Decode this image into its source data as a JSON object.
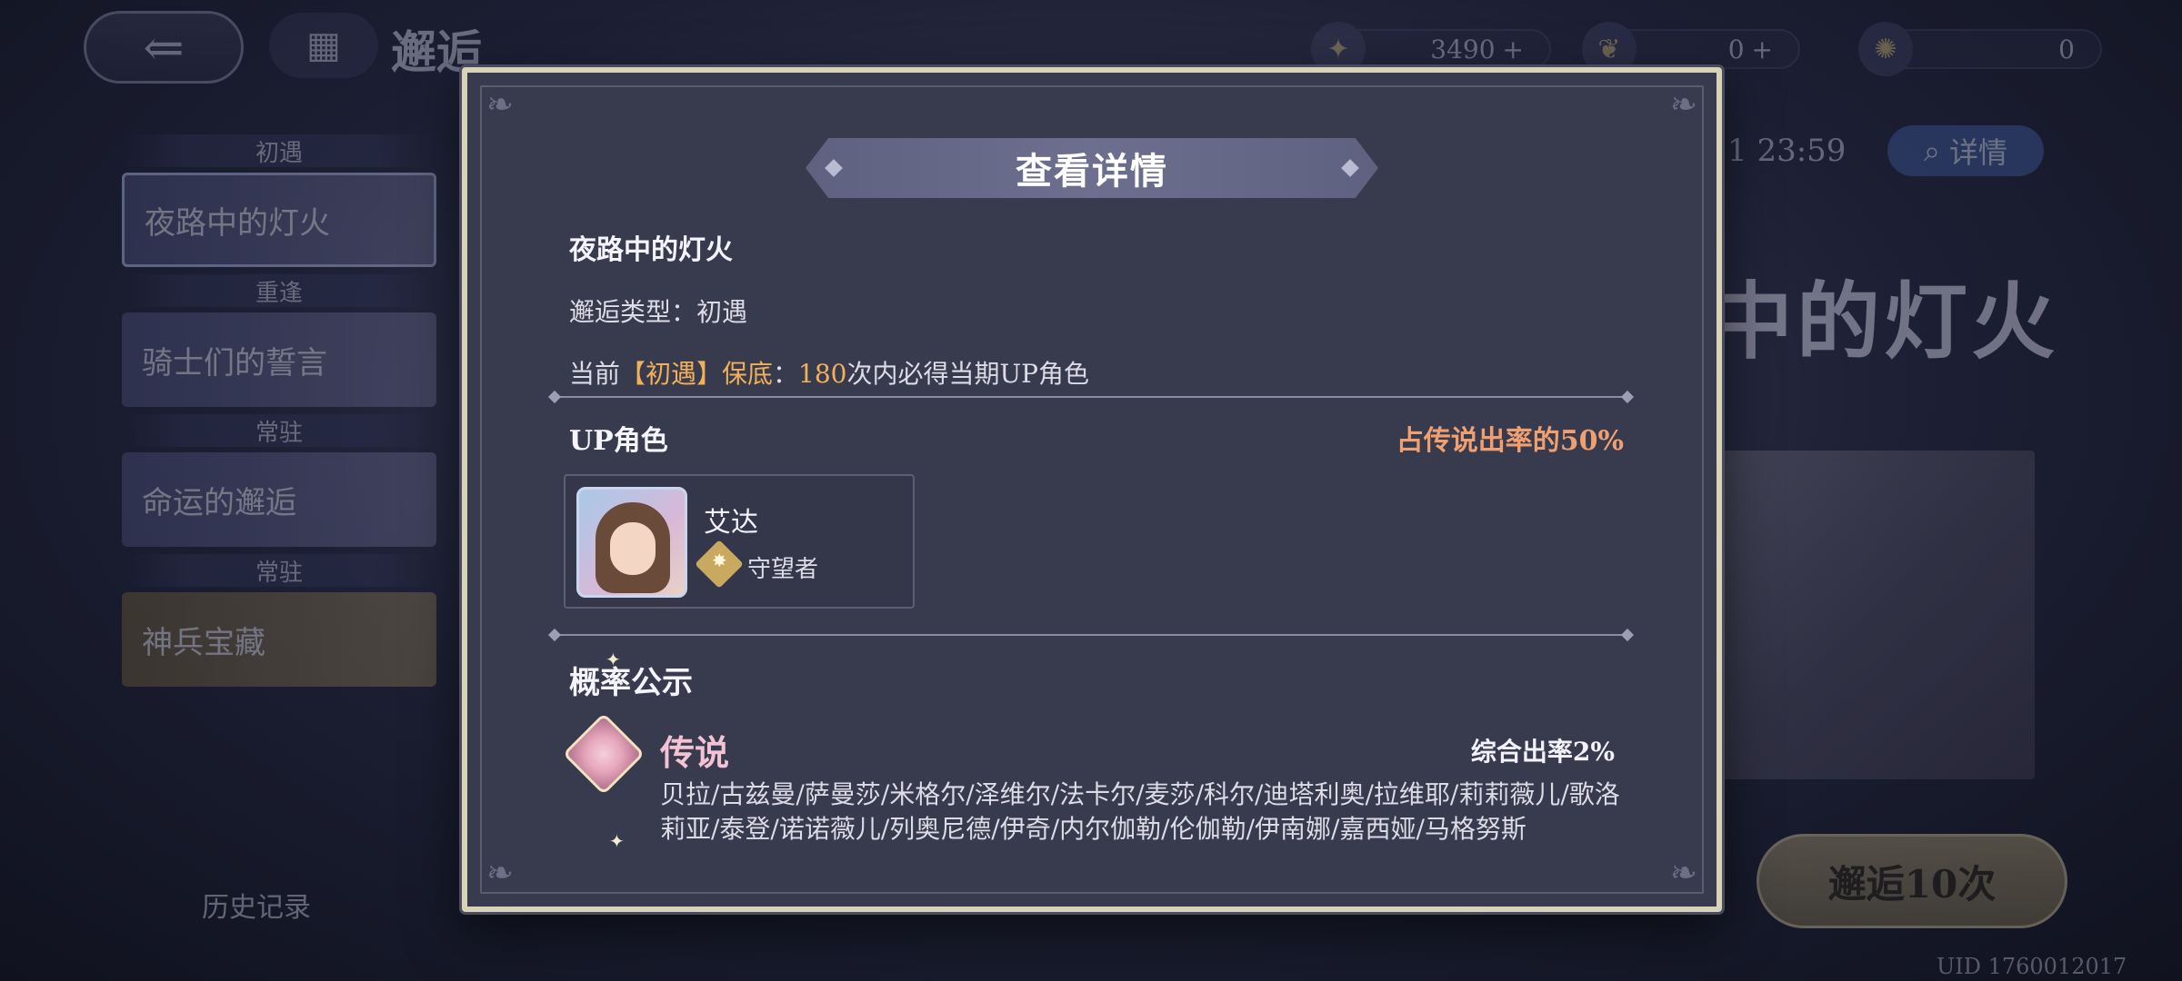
{
  "background": {
    "screen_title": "邂逅",
    "menu_icon": "grid-icon",
    "currencies": [
      {
        "icon": "crystal-icon",
        "value": "3490",
        "plus": "+"
      },
      {
        "icon": "feather-icon",
        "value": "0",
        "plus": "+"
      },
      {
        "icon": "flame-icon",
        "value": "0",
        "plus": ""
      }
    ],
    "side_list": [
      {
        "header": "初遇",
        "card": "夜路中的灯火",
        "active": true
      },
      {
        "header": "重逢",
        "card": "骑士们的誓言",
        "active": false
      },
      {
        "header": "常驻",
        "card": "命运的邂逅",
        "active": false
      },
      {
        "header": "常驻",
        "card": "神兵宝藏",
        "active": false
      }
    ],
    "history": "历史记录",
    "timer": "1   23:59",
    "details_button": "详情",
    "banner_title": "中的灯火",
    "pull_button": "邂逅10次",
    "pull_cost": "10",
    "uid": "UID 1760012017"
  },
  "modal": {
    "title": "查看详情",
    "banner_name": "夜路中的灯火",
    "type_label": "邂逅类型：",
    "type_value": "初遇",
    "pity_prefix": "当前",
    "pity_highlight": "【初遇】保底",
    "pity_colon": "：",
    "pity_count": "180",
    "pity_suffix": "次内必得当期UP角色",
    "up_label": "UP角色",
    "up_rate": "占传说出率的50%",
    "character": {
      "name": "艾达",
      "role_icon": "watcher-icon",
      "role": "守望者"
    },
    "probability_title": "概率公示",
    "tiers": [
      {
        "label": "传说",
        "icon": "legend-flower-icon",
        "rate": "综合出率2%",
        "characters": "贝拉/古兹曼/萨曼莎/米格尔/泽维尔/法卡尔/麦莎/科尔/迪塔利奥/拉维耶/莉莉薇儿/歌洛莉亚/泰登/诺诺薇儿/列奥尼德/伊奇/内尔伽勒/伦伽勒/伊南娜/嘉西娅/马格努斯"
      }
    ]
  }
}
